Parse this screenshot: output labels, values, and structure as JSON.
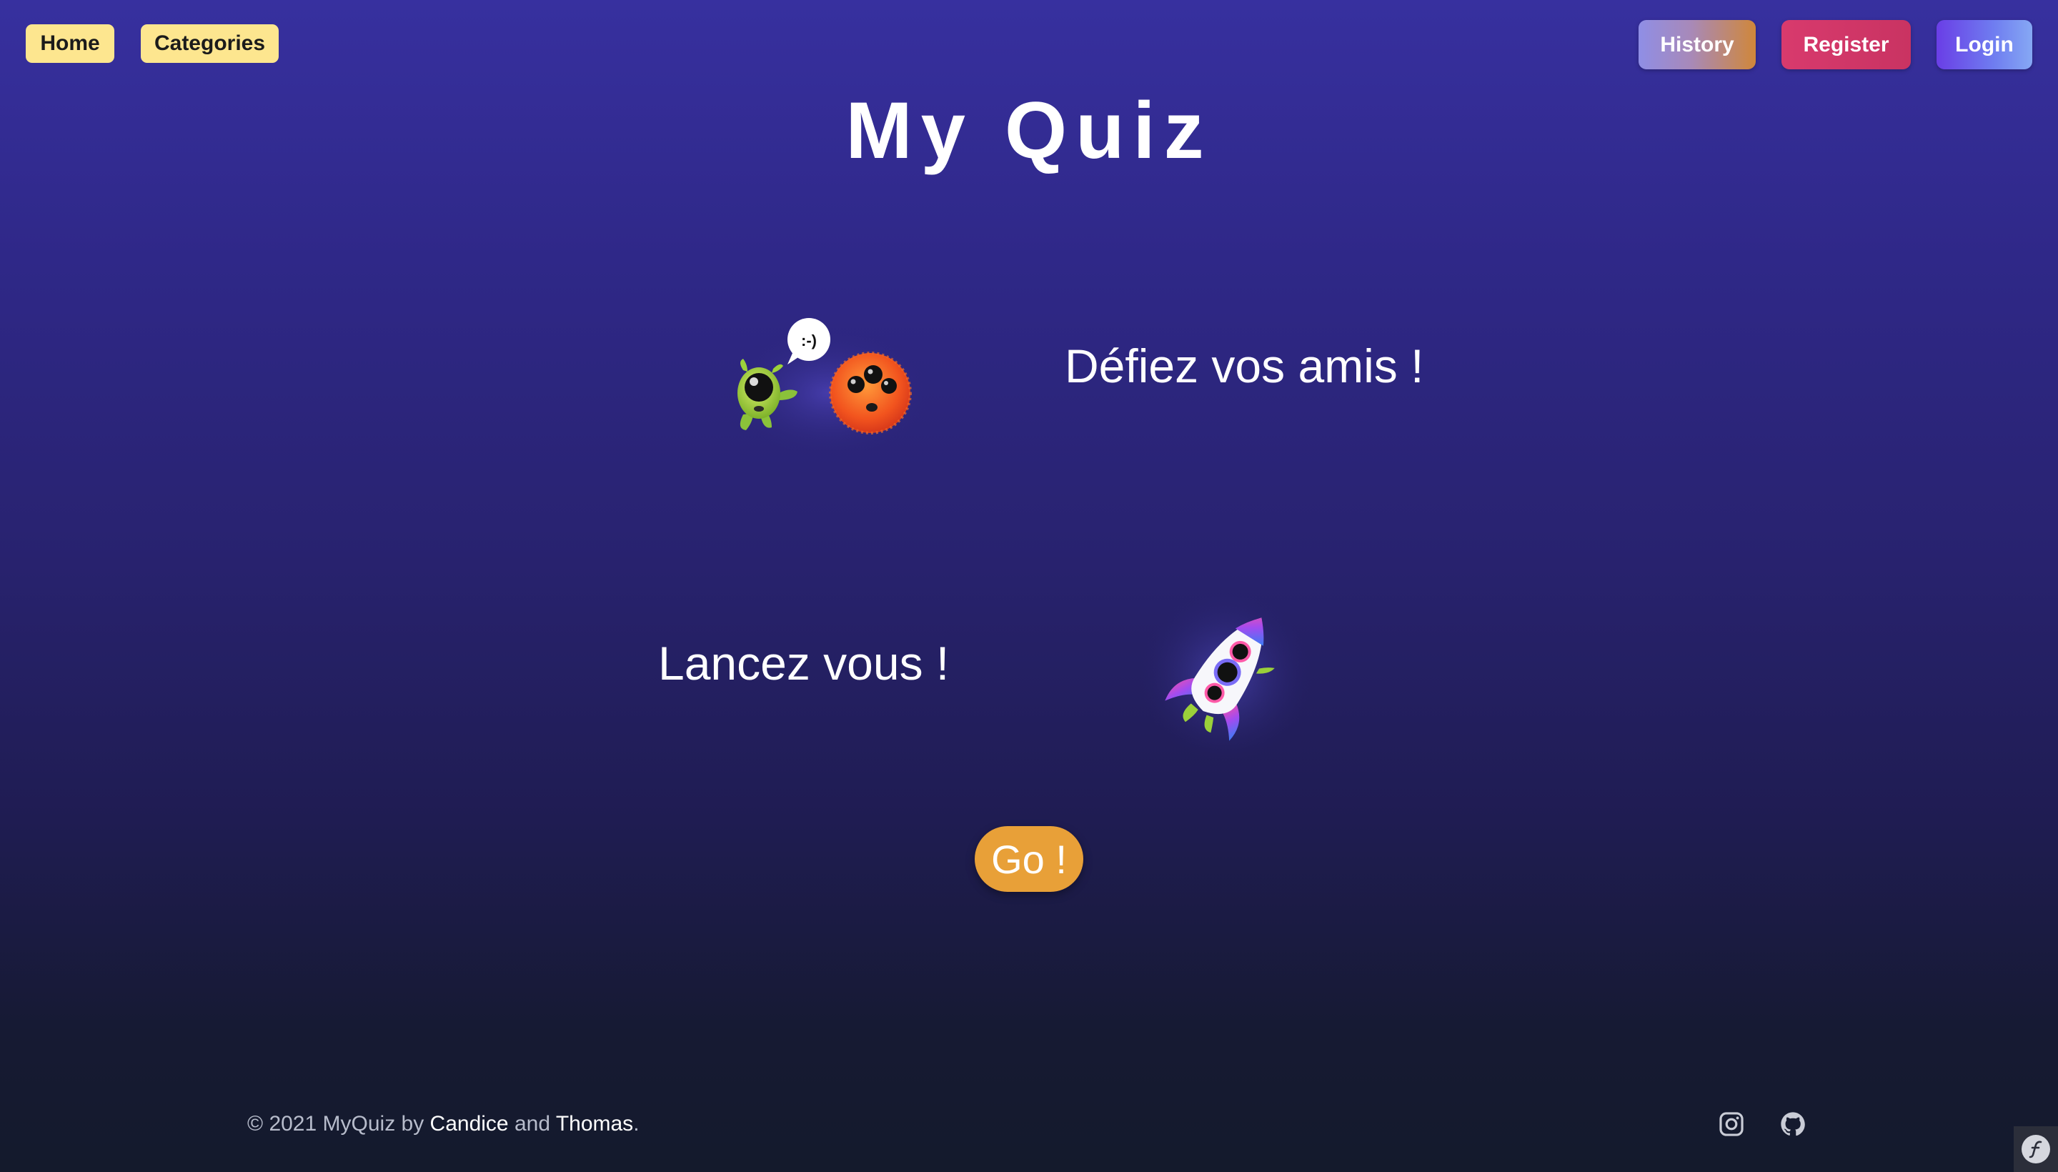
{
  "nav": {
    "home_label": "Home",
    "categories_label": "Categories",
    "history_label": "History",
    "register_label": "Register",
    "login_label": "Login"
  },
  "header": {
    "title": "My Quiz"
  },
  "features": [
    {
      "text": "Défiez vos amis !",
      "illustration": "monsters-chatting-icon",
      "speech_bubble": ":-)"
    },
    {
      "text": "Lancez vous !",
      "illustration": "rocket-icon"
    }
  ],
  "cta": {
    "go_label": "Go !"
  },
  "footer": {
    "copyright_prefix": "© 2021 MyQuiz by ",
    "author1": "Candice",
    "joiner": " and ",
    "author2": "Thomas",
    "suffix": ".",
    "icons": [
      "instagram-icon",
      "github-icon"
    ]
  },
  "colors": {
    "nav_pill_bg": "#fde68f",
    "register_bg": "#d83a6d",
    "go_button_bg": "#e8a038",
    "background_top": "#37309f",
    "background_bottom": "#141a2c"
  }
}
